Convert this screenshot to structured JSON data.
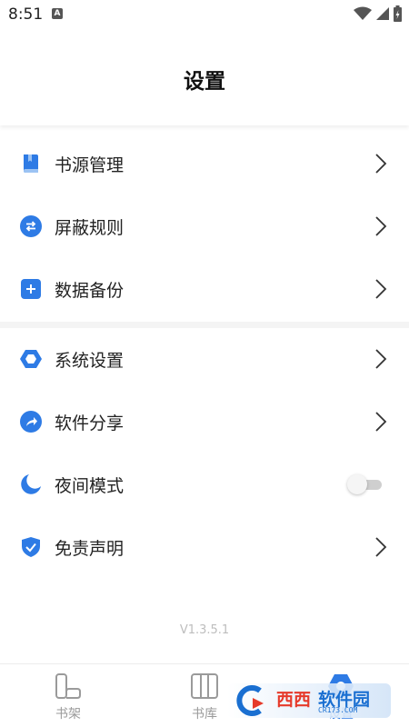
{
  "status_bar": {
    "time": "8:51",
    "notification_icon": "A"
  },
  "header": {
    "title": "设置"
  },
  "menu_group_1": [
    {
      "label": "书源管理",
      "icon": "book-source-icon"
    },
    {
      "label": "屏蔽规则",
      "icon": "swap-arrows-icon"
    },
    {
      "label": "数据备份",
      "icon": "plus-square-icon"
    }
  ],
  "menu_group_2": [
    {
      "label": "系统设置",
      "icon": "hexagon-settings-icon"
    },
    {
      "label": "软件分享",
      "icon": "share-arrow-icon"
    },
    {
      "label": "夜间模式",
      "icon": "moon-icon",
      "toggle_on": false
    },
    {
      "label": "免责声明",
      "icon": "shield-check-icon"
    }
  ],
  "version": "V1.3.5.1",
  "tabbar": {
    "tabs": [
      {
        "label": "书架",
        "icon": "bookshelf-icon",
        "active": false
      },
      {
        "label": "书库",
        "icon": "library-icon",
        "active": false
      },
      {
        "label": "设置",
        "icon": "settings-icon",
        "active": true
      }
    ]
  },
  "watermark": {
    "text_red": "西西",
    "text_blue": "软件园",
    "sub": "CR173.COM"
  },
  "colors": {
    "accent": "#2e7be5",
    "inactive": "#9a9a9a"
  }
}
